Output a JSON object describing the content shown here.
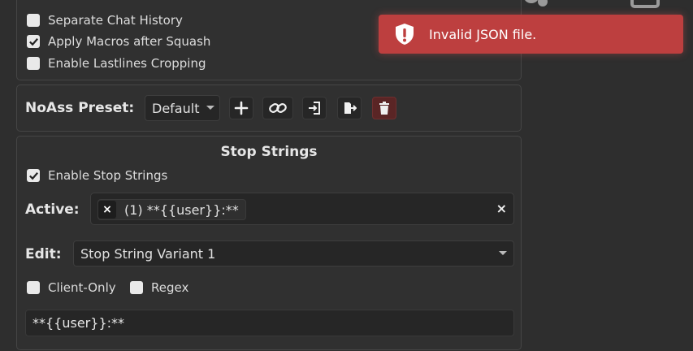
{
  "toast": {
    "message": "Invalid JSON file.",
    "icon": "shield-alert-icon",
    "color": "#bd3f3f"
  },
  "squash": {
    "options": [
      {
        "label": "Separate Chat History",
        "checked": false
      },
      {
        "label": "Apply Macros after Squash",
        "checked": true
      },
      {
        "label": "Enable Lastlines Cropping",
        "checked": false
      }
    ]
  },
  "preset": {
    "label": "NoAss Preset:",
    "selected": "Default",
    "actions": [
      "plus-icon",
      "link-icon",
      "import-icon",
      "export-icon",
      "trash-icon"
    ]
  },
  "stop_strings": {
    "title": "Stop Strings",
    "enable_label": "Enable Stop Strings",
    "enable_checked": true,
    "active_label": "Active:",
    "active_chip": "(1) **{{user}}:**",
    "chip_remove": "×",
    "clear_all": "×",
    "edit_label": "Edit:",
    "edit_selected": "Stop String Variant 1",
    "client_only_label": "Client-Only",
    "regex_label": "Regex",
    "value": "**{{user}}:**"
  }
}
